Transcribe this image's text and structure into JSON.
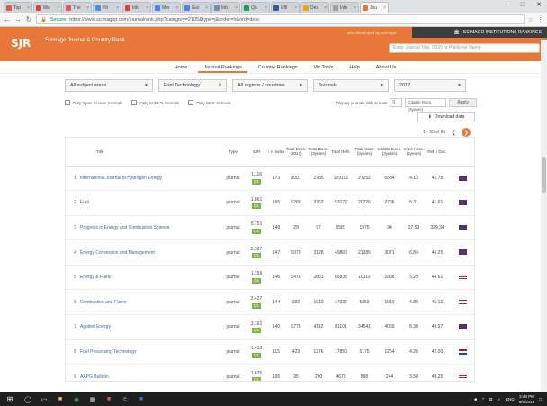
{
  "browser": {
    "tabs": [
      {
        "label": "Top",
        "color": "#e2574c"
      },
      {
        "label": "Mis",
        "color": "#d44638"
      },
      {
        "label": "The",
        "color": "#e2574c"
      },
      {
        "label": "Kh",
        "color": "#4a90d9"
      },
      {
        "label": "Inb",
        "color": "#d44638"
      },
      {
        "label": "Mer",
        "color": "#4285f4"
      },
      {
        "label": "Gui",
        "color": "#4285f4"
      },
      {
        "label": "Inb",
        "color": "#6f8fb8"
      },
      {
        "label": "Qu",
        "color": "#0f9d58"
      },
      {
        "label": "Effi",
        "color": "#3b5998"
      },
      {
        "label": "Des",
        "color": "#f4a300"
      },
      {
        "label": "Inte",
        "color": "#9aa0a6"
      },
      {
        "label": "Jou",
        "color": "#e8783a",
        "active": true
      }
    ],
    "secure_label": "Secure",
    "url": "https://www.scimagojr.com/journalrank.php?category=2105&type=j&order=h&ord=desc"
  },
  "header": {
    "logo": "SJR",
    "site_name": "Scimago Journal & Country Rank",
    "developed_by": "also developed by scimago:",
    "institutions": "SCIMAGO INSTITUTIONS RANKINGS",
    "search_placeholder": "Enter Journal Title, ISSN or Publisher Name"
  },
  "menu": [
    "Home",
    "Journal Rankings",
    "Country Rankings",
    "Viz Tools",
    "Help",
    "About Us"
  ],
  "menu_active": 1,
  "filters": {
    "area": "All subject areas",
    "category": "Fuel Technology",
    "region": "All regions / countries",
    "type": "Journals",
    "year": "2017"
  },
  "options": {
    "open_access": "Only Open Access Journals",
    "scielo": "Only SciELO Journals",
    "wos": "Only WoS Journals",
    "display_label": "Display journals with at least",
    "display_value": "0",
    "citable_select": "Citable Docs. (3years)",
    "apply": "Apply"
  },
  "download": "Download data",
  "pager": "1 - 50 of 86",
  "table": {
    "headers": {
      "title": "Title",
      "type": "Type",
      "sjr": "SJR",
      "h": "↓ H index",
      "docs_year": "Total Docs. (2017)",
      "docs_3y": "Total Docs. (3years)",
      "refs": "Total Refs.",
      "cites_3y": "Total Cites (3years)",
      "citable_3y": "Citable Docs. (3years)",
      "cites_doc": "Cites / Doc. (2years)",
      "ref_doc": "Ref. / Doc."
    },
    "rows": [
      {
        "rank": "1",
        "title": "International Journal of Hydrogen Energy",
        "type": "journal",
        "sjr": "1.116",
        "q": "Q1",
        "h": "173",
        "docs": "3091",
        "docs3": "2785",
        "refs": "129151",
        "cites": "27252",
        "citable": "6584",
        "cpd": "4.13",
        "rpd": "41.78",
        "flag": "uk"
      },
      {
        "rank": "2",
        "title": "Fuel",
        "type": "journal",
        "sjr": "1.861",
        "q": "Q1",
        "h": "165",
        "docs": "1280",
        "docs3": "3763",
        "refs": "53172",
        "cites": "20226",
        "citable": "2706",
        "cpd": "5.31",
        "rpd": "41.61",
        "flag": "uk"
      },
      {
        "rank": "3",
        "title": "Progress in Energy and Combustion Science",
        "type": "journal",
        "sjr": "5.751",
        "q": "Q1",
        "h": "148",
        "docs": "29",
        "docs3": "97",
        "refs": "5581",
        "cites": "1975",
        "citable": "94",
        "cpd": "27.53",
        "rpd": "329.34",
        "flag": "uk"
      },
      {
        "rank": "4",
        "title": "Energy Conversion and Management",
        "type": "journal",
        "sjr": "2.387",
        "q": "Q1",
        "h": "147",
        "docs": "1079",
        "docs3": "3128",
        "refs": "49800",
        "cites": "21286",
        "citable": "3071",
        "cpd": "6.84",
        "rpd": "46.25",
        "flag": "uk"
      },
      {
        "rank": "5",
        "title": "Energy & Fuels",
        "type": "journal",
        "sjr": "1.159",
        "q": "Q1",
        "h": "146",
        "docs": "1476",
        "docs3": "2861",
        "refs": "65838",
        "cites": "10112",
        "citable": "2838",
        "cpd": "3.29",
        "rpd": "44.61",
        "flag": "us"
      },
      {
        "rank": "6",
        "title": "Combustion and Flame",
        "type": "journal",
        "sjr": "2.427",
        "q": "Q1",
        "h": "144",
        "docs": "392",
        "docs3": "1010",
        "refs": "17237",
        "cites": "5353",
        "citable": "1010",
        "cpd": "4.89",
        "rpd": "45.12",
        "flag": "us"
      },
      {
        "rank": "7",
        "title": "Applied Energy",
        "type": "journal",
        "sjr": "3.162",
        "q": "Q1",
        "h": "140",
        "docs": "1775",
        "docs3": "4112",
        "refs": "81101",
        "cites": "34541",
        "citable": "4059",
        "cpd": "8.30",
        "rpd": "49.97",
        "flag": "uk"
      },
      {
        "rank": "8",
        "title": "Fuel Processing Technology",
        "type": "journal",
        "sjr": "1.413",
        "q": "Q1",
        "h": "115",
        "docs": "423",
        "docs3": "1276",
        "refs": "17850",
        "cites": "5175",
        "citable": "1264",
        "cpd": "4.26",
        "rpd": "42.00",
        "flag": "nl"
      },
      {
        "rank": "9",
        "title": "AAPG Bulletin",
        "type": "journal",
        "sjr": "1.625",
        "q": "Q1",
        "h": "105",
        "docs": "95",
        "docs3": "290",
        "refs": "4679",
        "cites": "898",
        "citable": "244",
        "cpd": "3.50",
        "rpd": "49.25",
        "flag": "us"
      }
    ]
  },
  "taskbar": {
    "clock_time": "3:43 PM",
    "clock_date": "9/6/2018",
    "lang": "ENG"
  }
}
